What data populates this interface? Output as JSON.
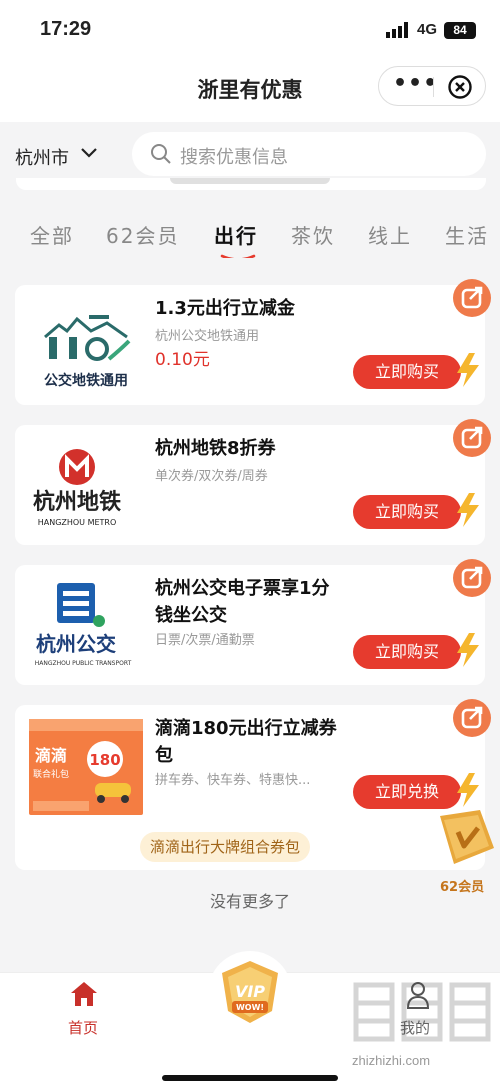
{
  "status_bar": {
    "time": "17:29",
    "network": "4G",
    "battery": "84"
  },
  "navbar": {
    "title": "浙里有优惠"
  },
  "search": {
    "city": "杭州市",
    "placeholder": "搜索优惠信息"
  },
  "tabs": [
    {
      "label": "全部",
      "active": false
    },
    {
      "label": "62会员",
      "active": false
    },
    {
      "label": "出行",
      "active": true
    },
    {
      "label": "茶饮",
      "active": false
    },
    {
      "label": "线上",
      "active": false
    },
    {
      "label": "生活",
      "active": false
    }
  ],
  "products": [
    {
      "name": "1.3元出行立减金",
      "desc": "杭州公交地铁通用",
      "price": "0.10元",
      "button": "立即购买",
      "thumb_text": "公交地铁通用"
    },
    {
      "name": "杭州地铁8折券",
      "desc": "单次券/双次券/周券",
      "button": "立即购买",
      "thumb_text": "杭州地铁",
      "thumb_subtext": "HANGZHOU METRO"
    },
    {
      "name": "杭州公交电子票享1分钱坐公交",
      "desc": "日票/次票/通勤票",
      "button": "立即购买",
      "thumb_text": "杭州公交",
      "thumb_subtext": "HANGZHOU  PUBLIC TRANSPORT"
    },
    {
      "name": "滴滴180元出行立减券包",
      "desc": "拼车券、快车券、特惠快...",
      "button": "立即兑换",
      "tag": "滴滴出行大牌组合券包",
      "thumb_text": "滴滴",
      "thumb_subtext": "联合礼包",
      "thumb_badge": "180"
    }
  ],
  "member_float": {
    "label": "62会员"
  },
  "footer_text": "没有更多了",
  "tabbar": {
    "home": "首页",
    "mine": "我的",
    "vip": "VIP",
    "vip_sub": "WOW!"
  },
  "watermark": {
    "url": "zhizhizhi.com"
  },
  "colors": {
    "accent_red": "#e63b2e",
    "share_orange": "#ef7a4a",
    "gold": "#e8a83c"
  }
}
